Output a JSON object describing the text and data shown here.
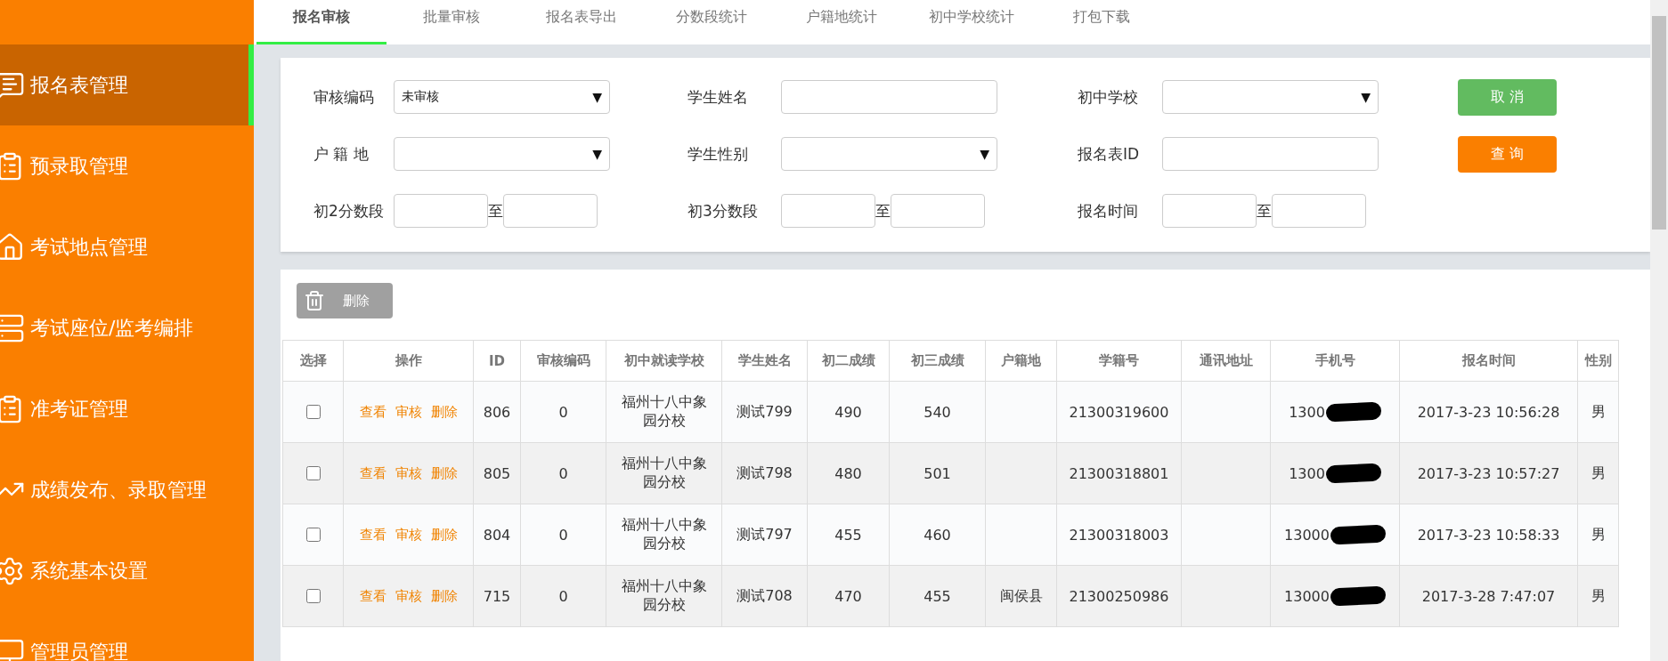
{
  "sidebar": {
    "items": [
      {
        "label": "报名表管理",
        "selected": true
      },
      {
        "label": "预录取管理",
        "selected": false
      },
      {
        "label": "考试地点管理",
        "selected": false
      },
      {
        "label": "考试座位/监考编排",
        "selected": false
      },
      {
        "label": "准考证管理",
        "selected": false
      },
      {
        "label": "成绩发布、录取管理",
        "selected": false
      },
      {
        "label": "系统基本设置",
        "selected": false
      },
      {
        "label": "管理员管理",
        "selected": false
      }
    ]
  },
  "tabs": [
    {
      "label": "报名审核",
      "selected": true
    },
    {
      "label": "批量审核",
      "selected": false
    },
    {
      "label": "报名表导出",
      "selected": false
    },
    {
      "label": "分数段统计",
      "selected": false
    },
    {
      "label": "户籍地统计",
      "selected": false
    },
    {
      "label": "初中学校统计",
      "selected": false
    },
    {
      "label": "打包下载",
      "selected": false
    }
  ],
  "form": {
    "rows": [
      {
        "fields": [
          {
            "kind": "select",
            "label": "审核编码",
            "value": "未审核",
            "caret": "▼"
          },
          {
            "kind": "text",
            "label": "学生姓名"
          },
          {
            "kind": "select",
            "label": "初中学校",
            "caret": "▼"
          }
        ],
        "button": {
          "label": "取 消",
          "kind": "cancel"
        }
      },
      {
        "fields": [
          {
            "kind": "select",
            "label": "户 籍 地",
            "caret": "▼"
          },
          {
            "kind": "select",
            "label": "学生性别",
            "caret": "▼"
          },
          {
            "kind": "text",
            "label": "报名表ID"
          }
        ],
        "button": {
          "label": "查 询",
          "kind": "query"
        }
      },
      {
        "fields": [
          {
            "kind": "range",
            "label": "初2分数段",
            "separator": "至"
          },
          {
            "kind": "range",
            "label": "初3分数段",
            "separator": "至"
          },
          {
            "kind": "range",
            "label": "报名时间",
            "separator": "至"
          }
        ]
      }
    ]
  },
  "toolbar": {
    "delete_button": "删除"
  },
  "table": {
    "columns": [
      "选择",
      "操作",
      "ID",
      "审核编码",
      "初中就读学校",
      "学生姓名",
      "初二成绩",
      "初三成绩",
      "户籍地",
      "学籍号",
      "通讯地址",
      "手机号",
      "报名时间",
      "性别"
    ],
    "rows": [
      {
        "checked": false,
        "actions": [
          "查看",
          "审核",
          "删除"
        ],
        "id": "806",
        "code": "0",
        "school": "福州十八中象园分校",
        "name": "测试799",
        "score2": "490",
        "score3": "540",
        "hometown": "",
        "student_no": "21300319600",
        "address": "",
        "phone": "1300",
        "phone_redacted": true,
        "time": "2017-3-23 10:56:28",
        "gender": "男"
      },
      {
        "checked": false,
        "actions": [
          "查看",
          "审核",
          "删除"
        ],
        "id": "805",
        "code": "0",
        "school": "福州十八中象园分校",
        "name": "测试798",
        "score2": "480",
        "score3": "501",
        "hometown": "",
        "student_no": "21300318801",
        "address": "",
        "phone": "1300",
        "phone_redacted": true,
        "time": "2017-3-23 10:57:27",
        "gender": "男"
      },
      {
        "checked": false,
        "actions": [
          "查看",
          "审核",
          "删除"
        ],
        "id": "804",
        "code": "0",
        "school": "福州十八中象园分校",
        "name": "测试797",
        "score2": "455",
        "score3": "460",
        "hometown": "",
        "student_no": "21300318003",
        "address": "",
        "phone": "13000",
        "phone_redacted": true,
        "time": "2017-3-23 10:58:33",
        "gender": "男"
      },
      {
        "checked": false,
        "actions": [
          "查看",
          "审核",
          "删除"
        ],
        "id": "715",
        "code": "0",
        "school": "福州十八中象园分校",
        "name": "测试708",
        "score2": "470",
        "score3": "455",
        "hometown": "闽侯县",
        "student_no": "21300250986",
        "address": "",
        "phone": "13000",
        "phone_redacted": true,
        "time": "2017-3-28 7:47:07",
        "gender": "男"
      }
    ]
  }
}
